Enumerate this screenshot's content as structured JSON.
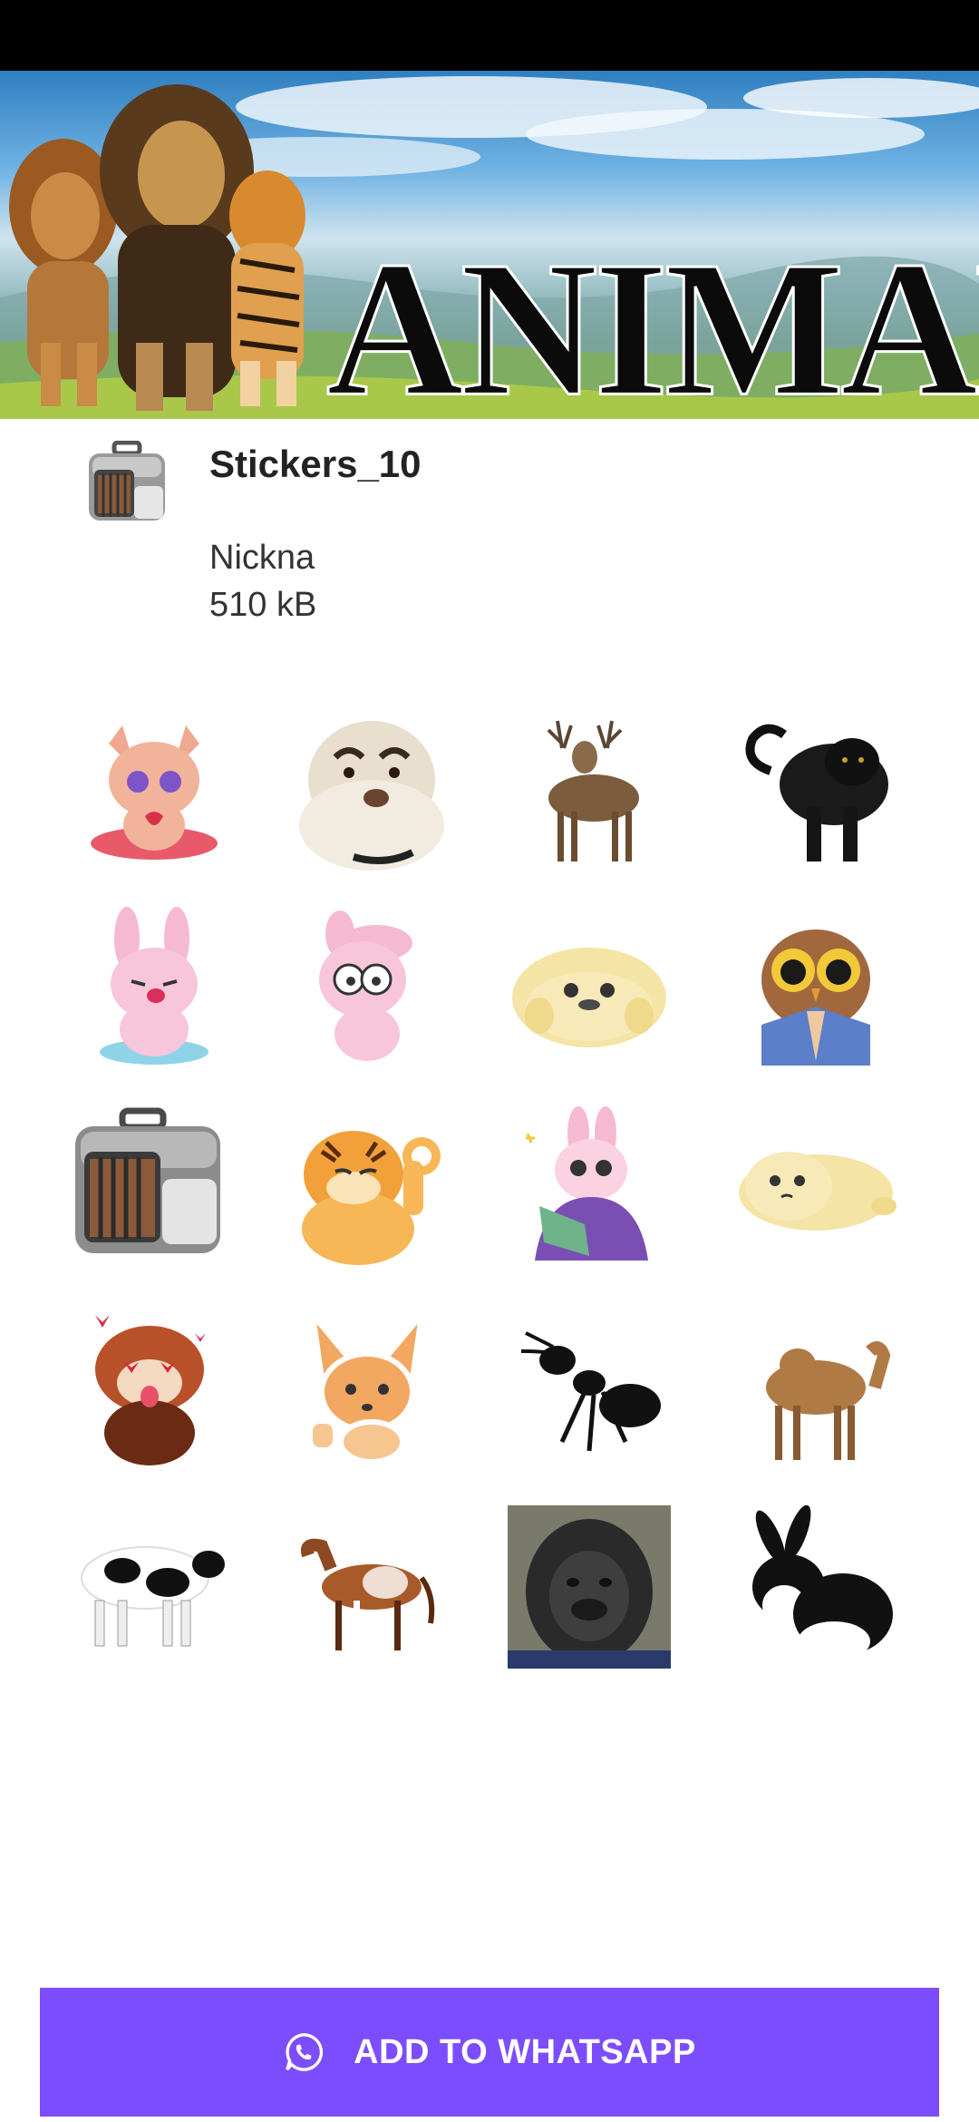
{
  "banner": {
    "title": "ANIMAL"
  },
  "pack": {
    "name": "Stickers_10",
    "author": "Nickna",
    "size": "510 kB"
  },
  "stickers": [
    {
      "name": "pink-chihuahua-hearts"
    },
    {
      "name": "dog-eyebrows-photo"
    },
    {
      "name": "deer-photo"
    },
    {
      "name": "black-panther-photo"
    },
    {
      "name": "pink-bunny-crying"
    },
    {
      "name": "pink-bunny-worried"
    },
    {
      "name": "yellow-seal-blob"
    },
    {
      "name": "owl-pleading"
    },
    {
      "name": "pet-carrier"
    },
    {
      "name": "tiger-ok-sign"
    },
    {
      "name": "bunny-reading-book"
    },
    {
      "name": "yellow-seal-lying"
    },
    {
      "name": "red-panda-hearts"
    },
    {
      "name": "fennec-fox-thumbs-up"
    },
    {
      "name": "black-ant"
    },
    {
      "name": "camel-photo"
    },
    {
      "name": "cow-photo"
    },
    {
      "name": "horse-photo"
    },
    {
      "name": "gorilla-photo"
    },
    {
      "name": "black-white-rabbit-photo"
    }
  ],
  "add_button": {
    "label": "ADD TO WHATSAPP",
    "icon": "whatsapp-icon",
    "color": "#7c4dff"
  }
}
